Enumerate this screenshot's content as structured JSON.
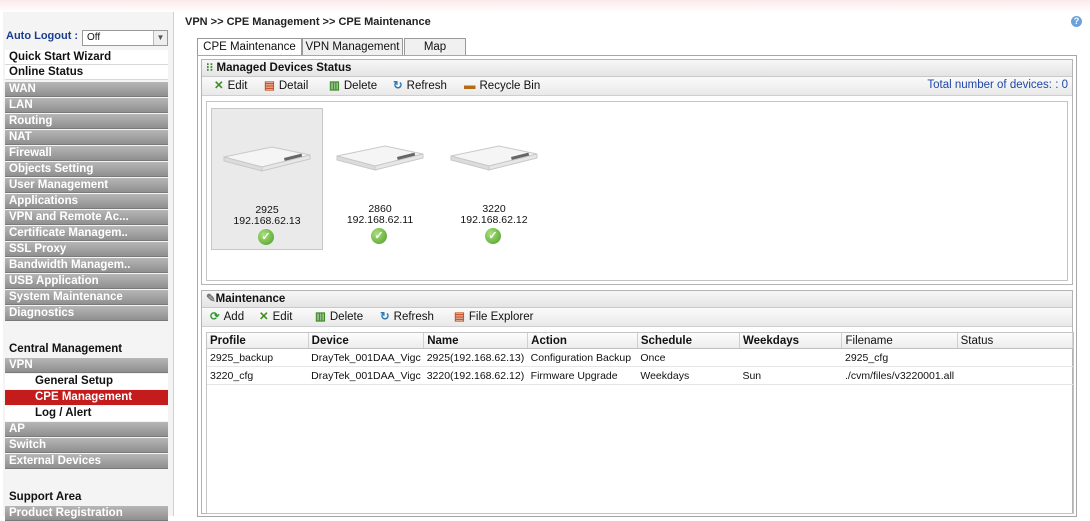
{
  "breadcrumb": "VPN >> CPE Management >> CPE Maintenance",
  "auto_logout": {
    "label": "Auto Logout :",
    "value": "Off"
  },
  "sidebar": [
    {
      "label": "Quick Start Wizard",
      "style": "white"
    },
    {
      "label": "Online Status",
      "style": "white"
    },
    {
      "label": "WAN",
      "style": "grey"
    },
    {
      "label": "LAN",
      "style": "grey"
    },
    {
      "label": "Routing",
      "style": "grey"
    },
    {
      "label": "NAT",
      "style": "grey"
    },
    {
      "label": "Firewall",
      "style": "grey"
    },
    {
      "label": "Objects Setting",
      "style": "grey"
    },
    {
      "label": "User Management",
      "style": "grey"
    },
    {
      "label": "Applications",
      "style": "grey"
    },
    {
      "label": "VPN and Remote Ac...",
      "style": "grey"
    },
    {
      "label": "Certificate Managem..",
      "style": "grey"
    },
    {
      "label": "SSL Proxy",
      "style": "grey"
    },
    {
      "label": "Bandwidth Managem..",
      "style": "grey"
    },
    {
      "label": "USB Application",
      "style": "grey"
    },
    {
      "label": "System Maintenance",
      "style": "grey"
    },
    {
      "label": "Diagnostics",
      "style": "grey"
    },
    {
      "label": "Central Management",
      "style": "plain"
    },
    {
      "label": "VPN",
      "style": "grey"
    },
    {
      "label": "General Setup",
      "style": "sub"
    },
    {
      "label": "CPE Management",
      "style": "active"
    },
    {
      "label": "Log / Alert",
      "style": "sub"
    },
    {
      "label": "AP",
      "style": "grey"
    },
    {
      "label": "Switch",
      "style": "grey"
    },
    {
      "label": "External Devices",
      "style": "grey"
    },
    {
      "label": "Support Area",
      "style": "plain"
    },
    {
      "label": "Product Registration",
      "style": "grey"
    }
  ],
  "tabs": [
    "CPE Maintenance",
    "VPN Management",
    "Map"
  ],
  "managed": {
    "title": "Managed Devices Status",
    "toolbar": [
      "Edit",
      "Detail",
      "Delete",
      "Refresh",
      "Recycle Bin"
    ],
    "total_label": "Total number of devices: : 0",
    "devices": [
      {
        "model": "2925",
        "ip": "192.168.62.13",
        "selected": true
      },
      {
        "model": "2860",
        "ip": "192.168.62.11",
        "selected": false
      },
      {
        "model": "3220",
        "ip": "192.168.62.12",
        "selected": false
      }
    ]
  },
  "maintenance": {
    "title": "Maintenance",
    "toolbar": [
      "Add",
      "Edit",
      "Delete",
      "Refresh",
      "File Explorer"
    ],
    "columns": [
      "Profile",
      "Device",
      "Name",
      "Action",
      "Schedule",
      "Weekdays",
      "Filename",
      "Status"
    ],
    "rows": [
      [
        "2925_backup",
        "DrayTek_001DAA_Vigc",
        "2925(192.168.62.13)",
        "Configuration Backup",
        "Once",
        "",
        "2925_cfg",
        ""
      ],
      [
        "3220_cfg",
        "DrayTek_001DAA_Vigc",
        "3220(192.168.62.12)",
        "Firmware Upgrade",
        "Weekdays",
        "Sun",
        "./cvm/files/v3220001.all",
        ""
      ]
    ]
  },
  "colors": {
    "active_menu": "#c41c1c",
    "total_text": "#1e47a8",
    "menu_grey": "#9e9e9e"
  }
}
